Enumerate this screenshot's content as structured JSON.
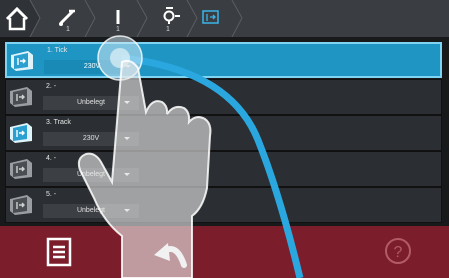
{
  "breadcrumb": [
    {
      "icon": "home-icon"
    },
    {
      "icon": "switch-icon",
      "number": "1"
    },
    {
      "icon": "line-icon",
      "number": "1"
    },
    {
      "icon": "lamp-icon",
      "number": "1"
    },
    {
      "icon": "exit-sign-icon"
    }
  ],
  "list": {
    "rows": [
      {
        "name": "1. Tick",
        "value": "230V",
        "selected": true
      },
      {
        "name": "2. -",
        "value": "Unbelegt",
        "selected": false
      },
      {
        "name": "3. Track",
        "value": "230V",
        "selected": false
      },
      {
        "name": "4. -",
        "value": "Unbelegt",
        "selected": false
      },
      {
        "name": "5. -",
        "value": "Unbelegt",
        "selected": false
      }
    ]
  },
  "bottombar": {
    "menu_icon": "menu-icon",
    "back_icon": "back-arrow-icon",
    "help_icon": "help-icon",
    "help_label": "?"
  },
  "colors": {
    "accent": "#1e95c3",
    "bottombar": "#7b1d2b",
    "background": "#1b1d20"
  }
}
